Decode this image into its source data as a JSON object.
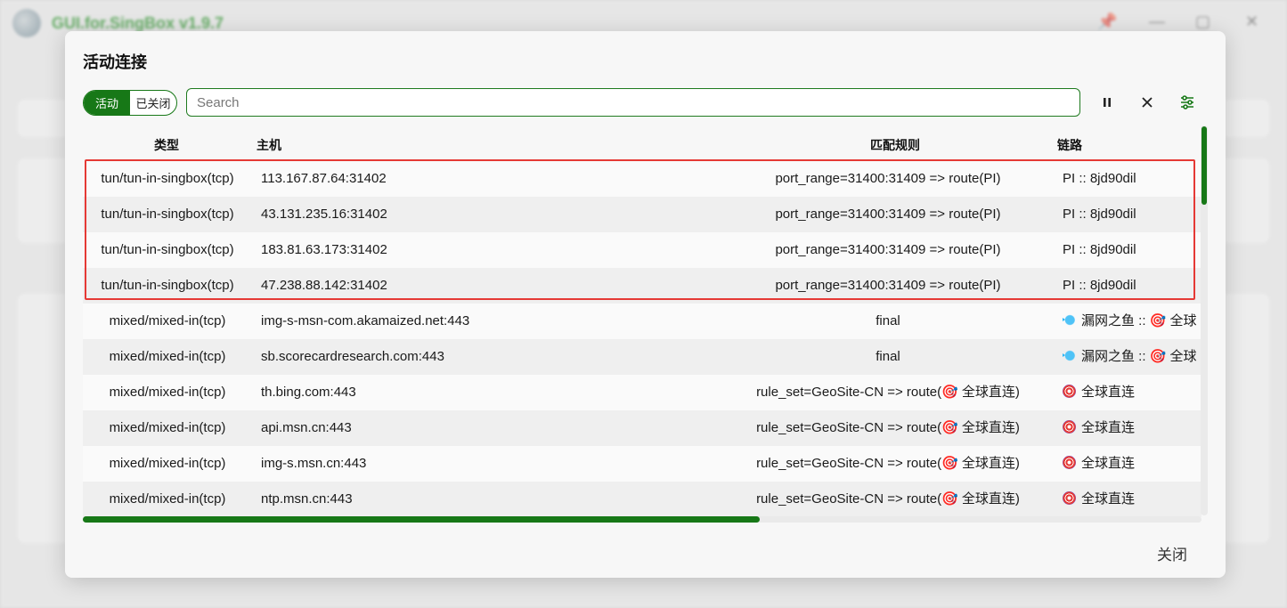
{
  "background": {
    "app_title": "GUI.for.SingBox v1.9.7"
  },
  "dialog": {
    "title": "活动连接",
    "tabs": [
      {
        "label": "活动",
        "active": true
      },
      {
        "label": "已关闭",
        "active": false
      }
    ],
    "search": {
      "value": "",
      "placeholder": "Search"
    },
    "toolbar": {
      "pause_icon": "pause-icon",
      "clear_icon": "close-icon",
      "settings_icon": "sliders-icon"
    },
    "table": {
      "headers": {
        "type": "类型",
        "host": "主机",
        "rule": "匹配规则",
        "chain": "链路"
      },
      "rows": [
        {
          "type": "tun/tun-in-singbox(tcp)",
          "host": "113.167.87.64:31402",
          "rule": "port_range=31400:31409 => route(PI)",
          "chain": "PI :: 8jd90dil",
          "rule_icon": "",
          "chain_icon": ""
        },
        {
          "type": "tun/tun-in-singbox(tcp)",
          "host": "43.131.235.16:31402",
          "rule": "port_range=31400:31409 => route(PI)",
          "chain": "PI :: 8jd90dil",
          "rule_icon": "",
          "chain_icon": ""
        },
        {
          "type": "tun/tun-in-singbox(tcp)",
          "host": "183.81.63.173:31402",
          "rule": "port_range=31400:31409 => route(PI)",
          "chain": "PI :: 8jd90dil",
          "rule_icon": "",
          "chain_icon": ""
        },
        {
          "type": "tun/tun-in-singbox(tcp)",
          "host": "47.238.88.142:31402",
          "rule": "port_range=31400:31409 => route(PI)",
          "chain": "PI :: 8jd90dil",
          "rule_icon": "",
          "chain_icon": ""
        },
        {
          "type": "mixed/mixed-in(tcp)",
          "host": "img-s-msn-com.akamaized.net:443",
          "rule": "final",
          "chain": "漏网之鱼 :: 🎯 全球",
          "rule_icon": "",
          "chain_icon": "fish"
        },
        {
          "type": "mixed/mixed-in(tcp)",
          "host": "sb.scorecardresearch.com:443",
          "rule": "final",
          "chain": "漏网之鱼 :: 🎯 全球",
          "rule_icon": "",
          "chain_icon": "fish"
        },
        {
          "type": "mixed/mixed-in(tcp)",
          "host": "th.bing.com:443",
          "rule": "rule_set=GeoSite-CN => route(🎯 全球直连)",
          "chain": "全球直连",
          "rule_icon": "",
          "chain_icon": "dart"
        },
        {
          "type": "mixed/mixed-in(tcp)",
          "host": "api.msn.cn:443",
          "rule": "rule_set=GeoSite-CN => route(🎯 全球直连)",
          "chain": "全球直连",
          "rule_icon": "",
          "chain_icon": "dart"
        },
        {
          "type": "mixed/mixed-in(tcp)",
          "host": "img-s.msn.cn:443",
          "rule": "rule_set=GeoSite-CN => route(🎯 全球直连)",
          "chain": "全球直连",
          "rule_icon": "",
          "chain_icon": "dart"
        },
        {
          "type": "mixed/mixed-in(tcp)",
          "host": "ntp.msn.cn:443",
          "rule": "rule_set=GeoSite-CN => route(🎯 全球直连)",
          "chain": "全球直连",
          "rule_icon": "",
          "chain_icon": "dart"
        }
      ]
    },
    "footer": {
      "close_label": "关闭"
    }
  },
  "colors": {
    "accent": "#177817",
    "highlight": "#e53935"
  }
}
